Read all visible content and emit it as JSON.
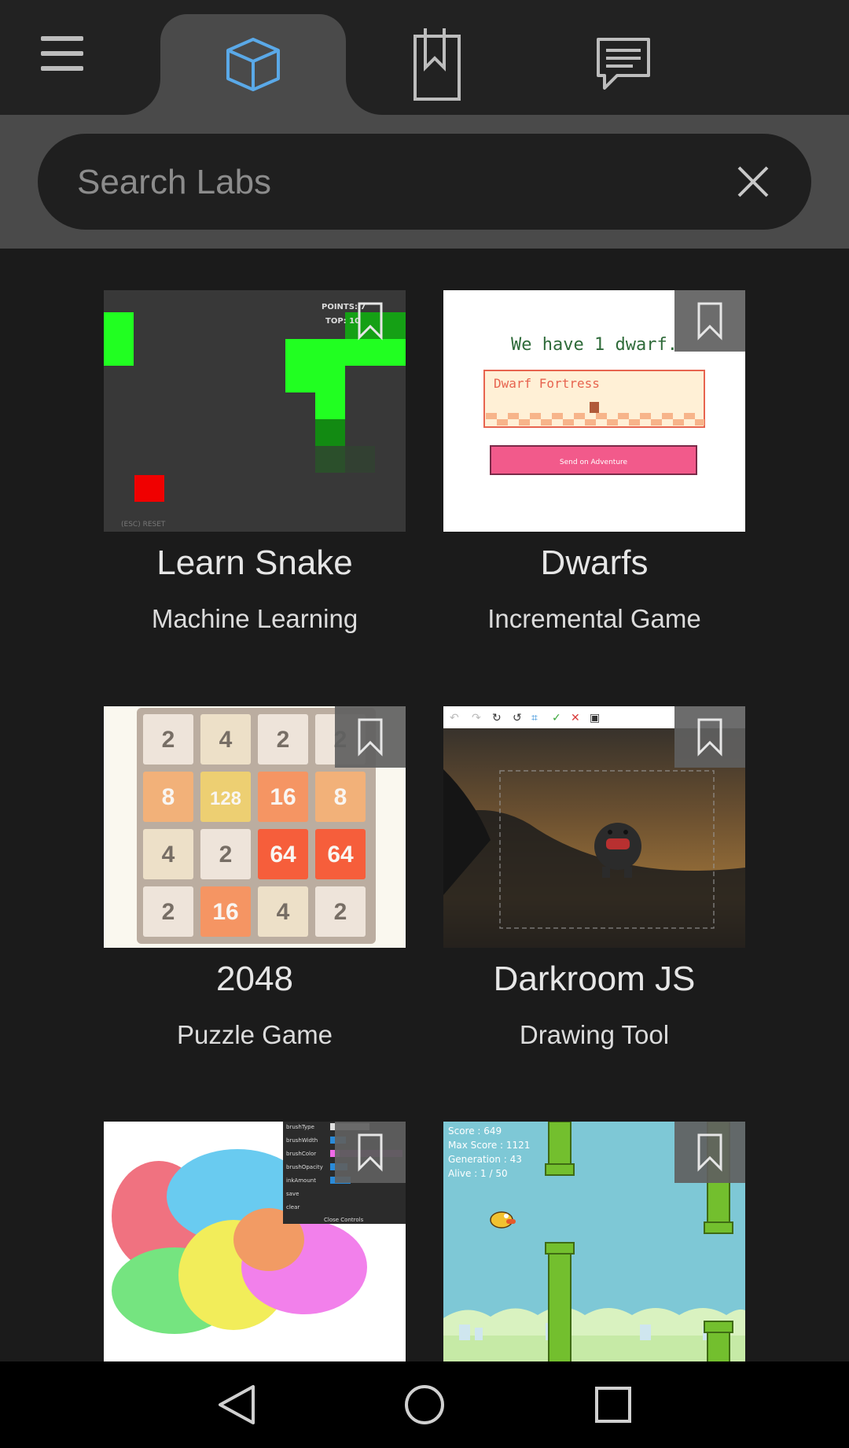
{
  "tabs": [
    {
      "icon": "cube-icon",
      "active": true
    },
    {
      "icon": "bookmarks-icon",
      "active": false
    },
    {
      "icon": "messages-icon",
      "active": false
    }
  ],
  "colors": {
    "accent": "#5aa9e8",
    "background": "#1b1b1b",
    "tabbar": "#222222",
    "active_tab": "#4a4a4a"
  },
  "search": {
    "placeholder": "Search Labs",
    "value": ""
  },
  "labs": [
    {
      "title": "Learn Snake",
      "subtitle": "Machine Learning",
      "thumb_text": [
        "POINTS: 7",
        "TOP: 10",
        "(ESC) RESET"
      ]
    },
    {
      "title": "Dwarfs",
      "subtitle": "Incremental Game",
      "thumb_text": [
        "We have 1 dwarf.",
        "Dwarf Fortress",
        "Send on Adventure"
      ]
    },
    {
      "title": "2048",
      "subtitle": "Puzzle Game",
      "thumb_tiles": [
        [
          "2",
          "4",
          "2",
          "2"
        ],
        [
          "8",
          "128",
          "16",
          "8"
        ],
        [
          "4",
          "2",
          "64",
          "64"
        ],
        [
          "2",
          "16",
          "4",
          "2"
        ]
      ]
    },
    {
      "title": "Darkroom JS",
      "subtitle": "Drawing Tool"
    },
    {
      "title": "",
      "subtitle": "",
      "thumb_text": [
        "brushType",
        "brushWidth",
        "brushColor",
        "brushOpacity",
        "inkAmount",
        "save",
        "clear",
        "Close Controls"
      ]
    },
    {
      "title": "",
      "subtitle": "",
      "thumb_text": [
        "Score : 649",
        "Max Score : 1121",
        "Generation : 43",
        "Alive : 1 / 50"
      ]
    }
  ],
  "navbar": [
    "back-icon",
    "home-icon",
    "recents-icon"
  ]
}
